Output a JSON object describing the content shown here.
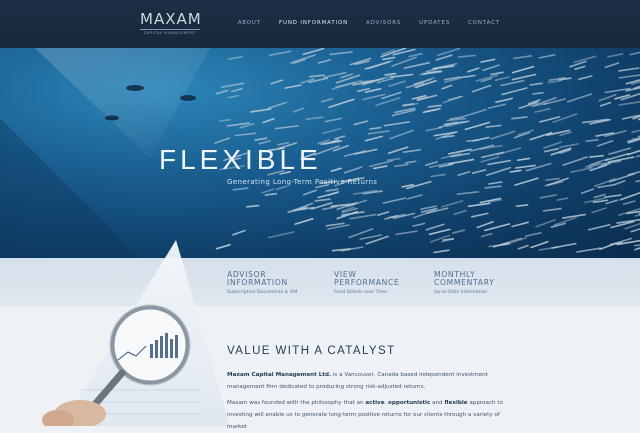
{
  "brand": {
    "name": "MAXAM",
    "tagline": "CAPITAL MANAGEMENT"
  },
  "nav": {
    "items": [
      {
        "label": "ABOUT"
      },
      {
        "label": "FUND INFORMATION",
        "active": true
      },
      {
        "label": "ADVISORS"
      },
      {
        "label": "UPDATES"
      },
      {
        "label": "CONTACT"
      }
    ]
  },
  "hero": {
    "title": "FLEXIBLE",
    "subtitle": "Generating Long-Term Positive Returns"
  },
  "links": [
    {
      "title_line1": "ADVISOR",
      "title_line2": "INFORMATION",
      "desc": "Subscription Documents & OM"
    },
    {
      "title_line1": "VIEW",
      "title_line2": "PERFORMANCE",
      "desc": "Fund Details over Time"
    },
    {
      "title_line1": "MONTHLY",
      "title_line2": "COMMENTARY",
      "desc": "Up-to-Date Information"
    }
  ],
  "main": {
    "heading": "VALUE WITH A CATALYST",
    "p1_bold": "Maxam Capital Management Ltd.",
    "p1_rest": " is a Vancouver, Canada based independent investment management firm dedicated to producing strong risk-adjusted returns.",
    "p2_a": "Maxam was founded with the philosophy that an ",
    "p2_b1": "active",
    "p2_c": ", ",
    "p2_b2": "opportunistic",
    "p2_d": " and ",
    "p2_b3": "flexible",
    "p2_e": " approach to investing will enable us to generate long-term positive returns for our clients through a variety of market"
  },
  "colors": {
    "header_bg": "#1c2f43",
    "hero_blue": "#1a5f91",
    "band_bg": "#d6e0ea",
    "link_text": "#4e6d8c"
  }
}
